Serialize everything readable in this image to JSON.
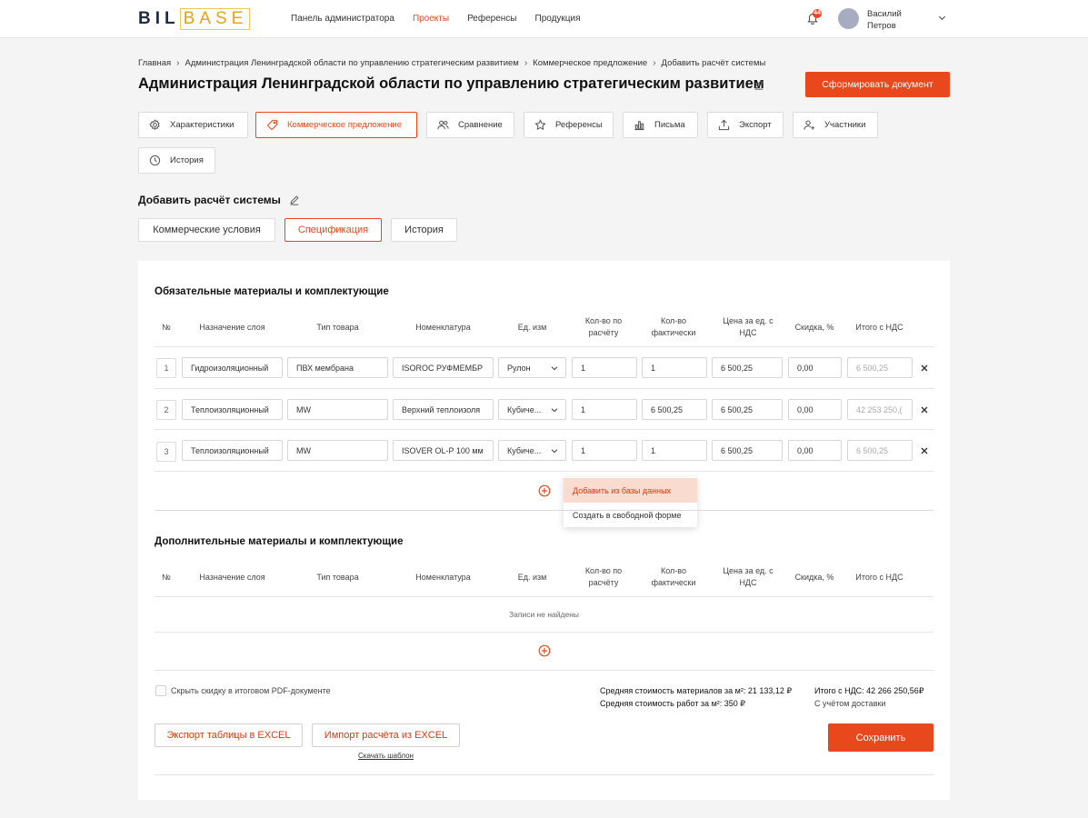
{
  "header": {
    "logo_part1": "BIL",
    "logo_part2": "BASE",
    "nav": [
      {
        "label": "Панель администратора",
        "active": false
      },
      {
        "label": "Проекты",
        "active": true
      },
      {
        "label": "Референсы",
        "active": false
      },
      {
        "label": "Продукция",
        "active": false
      }
    ],
    "notification_count": "44",
    "user_first_name": "Василий",
    "user_last_name": "Петров",
    "accent_color": "#e8481c"
  },
  "breadcrumb": [
    "Главная",
    "Администрация Ленинградской области по управлению стратегическим развитием",
    "Коммерческое предложение",
    "Добавить расчёт системы"
  ],
  "page_title": "Администрация Ленинградской области по управлению стратегическим развитием",
  "generate_button": "Сформировать документ",
  "section_tabs": [
    {
      "label": "Характеристики",
      "icon": "gear-icon",
      "active": false
    },
    {
      "label": "Коммерческое предложение",
      "icon": "tag-icon",
      "active": true
    },
    {
      "label": "Сравнение",
      "icon": "users-icon",
      "active": false
    },
    {
      "label": "Референсы",
      "icon": "star-icon",
      "active": false
    },
    {
      "label": "Письма",
      "icon": "chart-icon",
      "active": false
    },
    {
      "label": "Экспорт",
      "icon": "upload-icon",
      "active": false
    },
    {
      "label": "Участники",
      "icon": "user-plus-icon",
      "active": false
    },
    {
      "label": "История",
      "icon": "clock-icon",
      "active": false
    }
  ],
  "subtitle": "Добавить расчёт системы",
  "sub_tabs": [
    {
      "label": "Коммерческие условия",
      "active": false
    },
    {
      "label": "Спецификация",
      "active": true
    },
    {
      "label": "История",
      "active": false
    }
  ],
  "columns": [
    "№",
    "Назначение слоя",
    "Тип товара",
    "Номенклатура",
    "Ед. изм",
    "Кол-во по расчёту",
    "Кол-во фактически",
    "Цена за ед. с НДС",
    "Скидка, %",
    "Итого с НДС"
  ],
  "required_block": {
    "title": "Обязательные материалы и комплектующие",
    "rows": [
      {
        "num": "1",
        "layer": "Гидроизоляционный",
        "type": "ПВХ мембрана",
        "nomenclature": "ISOROC РУФМЕМБР",
        "unit": "Рулон",
        "qty_calc": "1",
        "qty_fact": "1",
        "price": "6 500,25",
        "discount": "0,00",
        "total": "6 500,25"
      },
      {
        "num": "2",
        "layer": "Теплоизоляционный",
        "type": "MW",
        "nomenclature": "Верхний теплоизоля",
        "unit": "Кубиче...",
        "qty_calc": "1",
        "qty_fact": "6 500,25",
        "price": "6 500,25",
        "discount": "0,00",
        "total": "42 253 250,("
      },
      {
        "num": "3",
        "layer": "Теплоизоляционный",
        "type": "MW",
        "nomenclature": "ISOVER OL-P   100 мм",
        "unit": "Кубиче...",
        "qty_calc": "1",
        "qty_fact": "1",
        "price": "6 500,25",
        "discount": "0,00",
        "total": "6 500,25"
      }
    ]
  },
  "add_menu": {
    "items": [
      "Добавить из базы данных",
      "Создать в свободной форме"
    ]
  },
  "extra_block": {
    "title": "Дополнительные материалы и комплектующие",
    "empty_text": "Записи не найдены"
  },
  "footer": {
    "hide_discount_label": "Скрыть скидку в итоговом PDF-документе",
    "avg_materials": "Средняя стоимость материалов за м²: 21 133,12 ₽",
    "avg_works": "Средняя стоимость работ за м²: 350 ₽",
    "total": "Итого с НДС: 42 266 250,56₽",
    "total_note": "С учётом доставки",
    "export_excel": "Экспорт таблицы в EXCEL",
    "import_excel": "Импорт расчёта из EXCEL",
    "download_template": "Скачать шаблон",
    "save": "Сохранить"
  }
}
